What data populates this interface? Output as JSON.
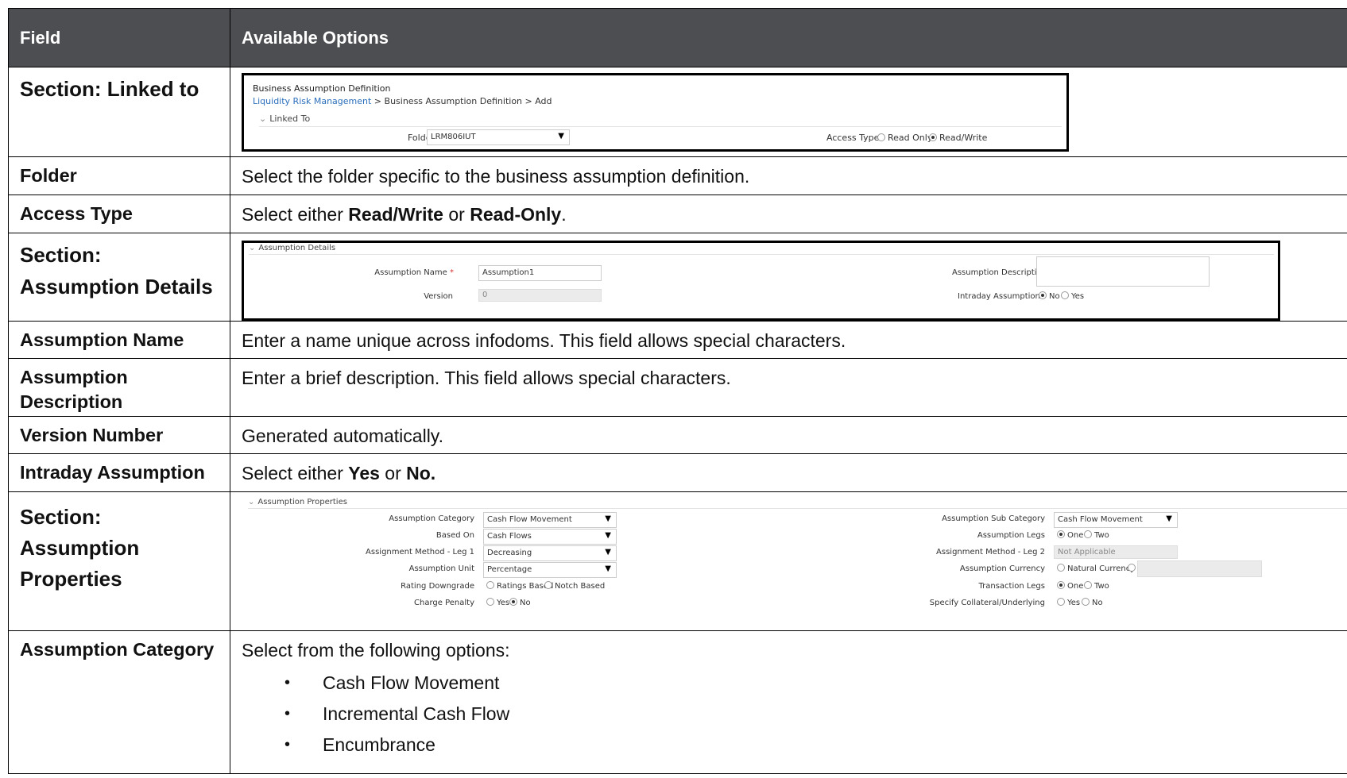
{
  "table": {
    "header": {
      "field": "Field",
      "options": "Available Options"
    },
    "rows": {
      "linked": {
        "field": "Section: Linked to"
      },
      "folder": {
        "field": "Folder",
        "text": "Select the folder specific to the business assumption definition."
      },
      "access": {
        "field": "Access Type",
        "pre": "Select either ",
        "b1": "Read/Write",
        "mid": " or ",
        "b2": "Read-Only",
        "post": "."
      },
      "details": {
        "field_line1": "Section:",
        "field_line2": "Assumption Details"
      },
      "name": {
        "field": "Assumption Name",
        "text": "Enter a name unique across infodoms. This field allows special characters."
      },
      "desc": {
        "field_line1": "Assumption",
        "field_line2": "Description",
        "text": "Enter a brief description. This field allows special characters."
      },
      "version": {
        "field": "Version Number",
        "text": "Generated automatically."
      },
      "intraday": {
        "field": "Intraday Assumption",
        "pre": "Select either ",
        "b1": "Yes",
        "mid": " or ",
        "b2": "No."
      },
      "props": {
        "field_line1": "Section:",
        "field_line2": "Assumption",
        "field_line3": "Properties"
      },
      "category": {
        "field": "Assumption Category",
        "text": "Select from the following options:",
        "bullets": [
          "Cash Flow Movement",
          "Incremental Cash Flow",
          "Encumbrance"
        ]
      }
    }
  },
  "shot_linked": {
    "title": "Business Assumption Definition",
    "crumb_link": "Liquidity Risk Management",
    "crumb_rest": " > Business Assumption Definition > Add",
    "section": "Linked To",
    "folder_label": "Folder",
    "folder_value": "LRM806IUT",
    "access_label": "Access Type",
    "opt_read_only": "Read Only",
    "opt_read_write": "Read/Write"
  },
  "shot_details": {
    "section": "Assumption Details",
    "name_label": "Assumption Name",
    "name_value": "Assumption1",
    "version_label": "Version",
    "version_value": "0",
    "desc_label": "Assumption Description",
    "intraday_label": "Intraday Assumption",
    "opt_no": "No",
    "opt_yes": "Yes",
    "required_mark": "*"
  },
  "shot_props": {
    "section": "Assumption Properties",
    "category_label": "Assumption Category",
    "category_value": "Cash Flow Movement",
    "based_on_label": "Based On",
    "based_on_value": "Cash Flows",
    "method1_label": "Assignment Method - Leg 1",
    "method1_value": "Decreasing",
    "unit_label": "Assumption Unit",
    "unit_value": "Percentage",
    "rating_label": "Rating Downgrade",
    "rating_opt1": "Ratings Based",
    "rating_opt2": "Notch Based",
    "penalty_label": "Charge Penalty",
    "yes": "Yes",
    "no": "No",
    "subcat_label": "Assumption Sub Category",
    "subcat_value": "Cash Flow Movement",
    "legs_label": "Assumption Legs",
    "one": "One",
    "two": "Two",
    "method2_label": "Assignment Method - Leg 2",
    "method2_value": "Not Applicable",
    "currency_label": "Assumption Currency",
    "currency_opt": "Natural Currency",
    "txn_legs_label": "Transaction Legs",
    "collateral_label": "Specify Collateral/Underlying"
  }
}
